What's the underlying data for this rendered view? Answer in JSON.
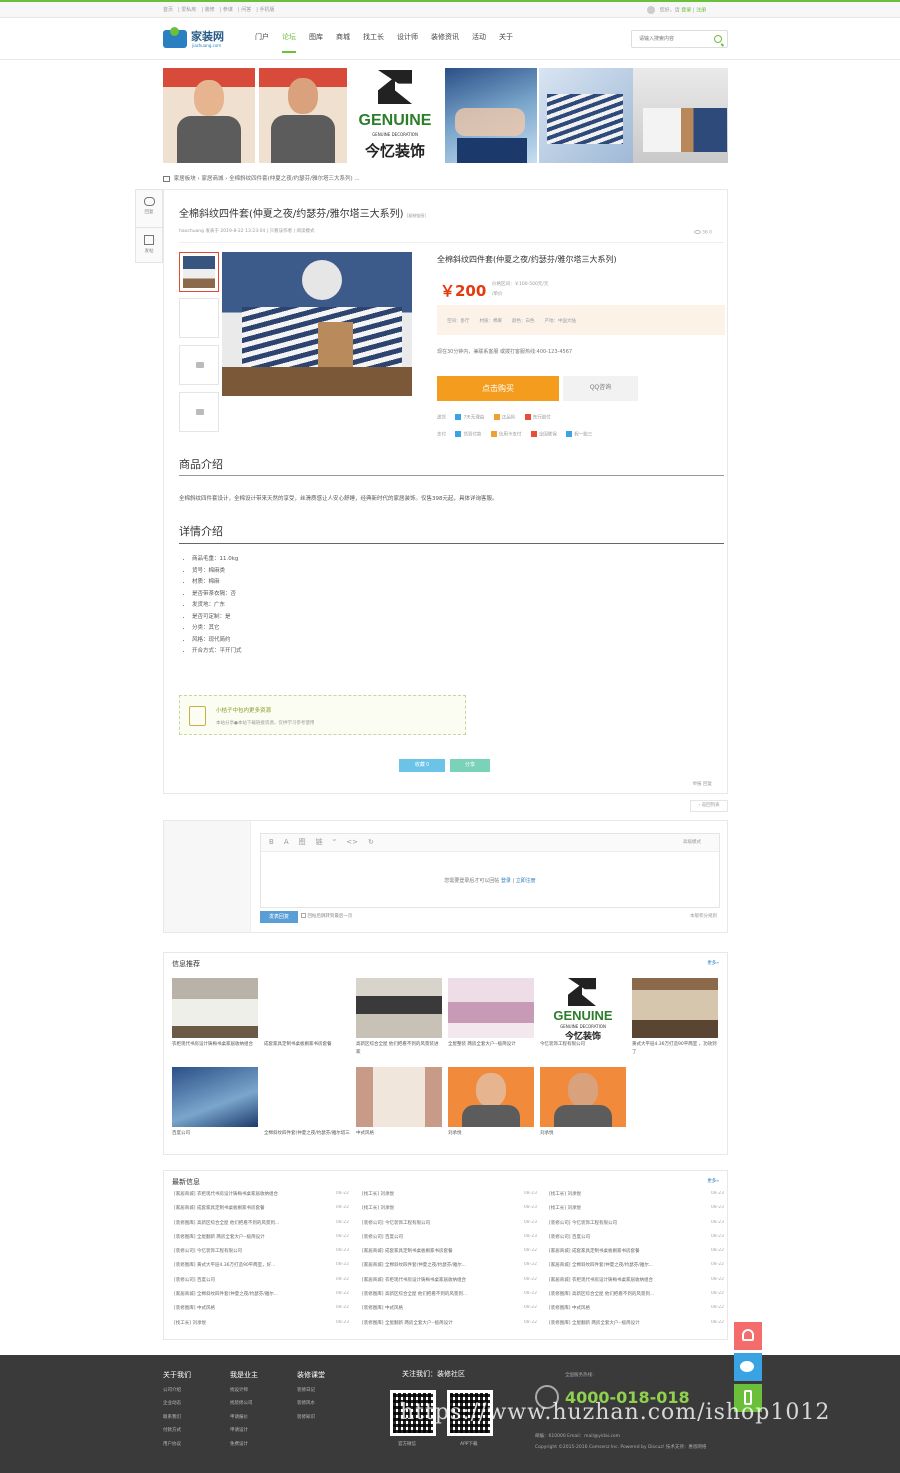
{
  "topbar": {
    "links": [
      "首页",
      "爱私房",
      "装修",
      "参谋",
      "问答",
      "手机版"
    ],
    "greeting": "您好，请",
    "login": "登录",
    "register": "注册"
  },
  "logo": {
    "name": "家装网",
    "domain": "jiazhuang.com"
  },
  "nav": [
    "门户",
    "论坛",
    "图库",
    "商城",
    "找工长",
    "设计师",
    "装修资讯",
    "活动",
    "关于"
  ],
  "search": {
    "placeholder": "请输入搜索内容"
  },
  "banner": {
    "genuine": "GENUINE",
    "genuine_sub": "GENUINE DECORATION",
    "genuine_cn": "今忆装饰"
  },
  "breadcrumb": "家居板块 › 家居商城 › 全棉斜纹四件套(仲夏之夜/约瑟芬/雅尔塔三大系列) ...",
  "sidetools": [
    "回复",
    "发帖"
  ],
  "post": {
    "title": "全棉斜纹四件套(仲夏之夜/约瑟芬/雅尔塔三大系列)",
    "title_tag": "[复制链接]",
    "meta": "haochuang  发表于 2019-8-22 13:23:04  |  只看该作者  |  阅读模式",
    "stats": "36    0",
    "product_title": "全棉斜纹四件套(仲夏之夜/约瑟芬/雅尔塔三大系列)",
    "price": "￥200",
    "price_range": "价格区间：￥100-500元/元",
    "unit": "/单价",
    "attrs": [
      "空间：卧厅",
      "材质：棉麻",
      "颜色：白色",
      "产地：中国大陆"
    ],
    "desc": "现在30分钟内，兼联系客服 或拨打客服热线:400-123-4567",
    "buy": "点击购买",
    "qq": "QQ咨询",
    "service_rows": [
      {
        "label": "送货",
        "items": [
          "7天无理由",
          "正品险",
          "先行赔付"
        ]
      },
      {
        "label": "支付",
        "items": [
          "货到付款",
          "信用卡支付",
          "全国联保",
          "假一赔三"
        ]
      }
    ],
    "intro_head": "商品介绍",
    "intro": "全棉斜纹四件套设计，全棉设计带来天然的享受，丝滑质感让人安心舒睡，经典新时代的家居装饰。仅售398元起，具体详询客服。",
    "detail_head": "详情介绍",
    "details": [
      "商品毛重：11.0kg",
      "货号：棉麻类",
      "材质：棉麻",
      "是否带茶衣隔：否",
      "发货地：广东",
      "是否可定制：是",
      "分类：其它",
      "风格：现代简约",
      "开合方式：平开门式"
    ],
    "download_title": "小桔子中包内更多资源",
    "download_sub": "本站分享●本站下载链接资源，仅供学习参考使用",
    "fav": "收藏 0",
    "share": "分享",
    "footer_links": "举报    回复"
  },
  "back_list": "‹ 返回列表",
  "reply": {
    "toolbar": [
      "B",
      "A",
      "图",
      "链",
      "“",
      "<>",
      "↻"
    ],
    "advanced": "高级模式",
    "login_msg": "您需要登录后才可以回帖",
    "login": "登录",
    "sep": " | ",
    "register": "立即注册",
    "submit": "发表回复",
    "checkbox": "回帖后跳转到最后一页",
    "rules": "本版积分规则"
  },
  "info": {
    "title": "信息推荐",
    "more": "更多»",
    "cards": [
      "衣柜现代书房设计铸梅书桌家居收纳组合",
      "成套家具定制书桌板橱家书房套餐",
      "高新区综合全屋 他们把看不到的风景装进家",
      "全屋整装 两房全套大户--极简设计",
      "今忆装饰工程有限公司",
      "黄式大平层4.36万打造90平两室 ，功效到了",
      "百度公司",
      "全棉斜纹四件套(仲夏之夜/约瑟芬/雅尔塔三",
      "中式风格",
      "刘承悦",
      "刘承悦"
    ]
  },
  "latest": {
    "title": "最新信息",
    "more": "更多»",
    "cols": [
      [
        [
          "[家居商城] 衣柜现代书房设计铸梅书桌家居收纳组合",
          "08-22"
        ],
        [
          "[家居商城] 成套家具定制书桌板橱家书房套餐",
          "08-22"
        ],
        [
          "[装修图库] 高新区综合全屋 他们把看不到的风景到...",
          "08-22"
        ],
        [
          "[装修图库] 全屋翻新 两房全套大户--极简设计",
          "08-22"
        ],
        [
          "[装修公司] 今忆装饰工程有限公司",
          "08-23"
        ],
        [
          "[装修图库] 黄式大平层4.36万打造90平两室，好...",
          "08-22"
        ],
        [
          "[装修公司] 百度公司",
          "08-22"
        ],
        [
          "[家居商城] 全棉斜纹四件套(仲夏之夜/约瑟芬/雅尔...",
          "08-22"
        ],
        [
          "[装修图库] 中式风格",
          "08-22"
        ],
        [
          "[找工长] 刘承悦",
          "08-23"
        ]
      ],
      [
        [
          "[找工长] 刘承悦",
          "08-23"
        ],
        [
          "[找工长] 刘承悦",
          "08-23"
        ],
        [
          "[装修公司] 今忆装饰工程有限公司",
          "08-23"
        ],
        [
          "[装修公司] 百度公司",
          "08-23"
        ],
        [
          "[家居商城] 成套家具定制书桌板橱家书房套餐",
          "08-22"
        ],
        [
          "[家居商城] 全棉斜纹四件套(仲夏之夜/约瑟芬/雅尔...",
          "08-22"
        ],
        [
          "[家居商城] 衣柜现代书房设计铸梅书桌家居收纳组合",
          "08-22"
        ],
        [
          "[装修图库] 高新区综合全屋 他们把看不到的风景到...",
          "08-22"
        ],
        [
          "[装修图库] 中式风格",
          "08-22"
        ],
        [
          "[装修图库] 全屋翻新 两房全套大户--极简设计",
          "08-22"
        ]
      ],
      [
        [
          "[找工长] 刘承悦",
          "08-23"
        ],
        [
          "[找工长] 刘承悦",
          "08-23"
        ],
        [
          "[装修公司] 今忆装饰工程有限公司",
          "08-23"
        ],
        [
          "[装修公司] 百度公司",
          "08-23"
        ],
        [
          "[家居商城] 成套家具定制书桌板橱家书房套餐",
          "08-22"
        ],
        [
          "[家居商城] 全棉斜纹四件套(仲夏之夜/约瑟芬/雅尔...",
          "08-22"
        ],
        [
          "[家居商城] 衣柜现代书房设计铸梅书桌家居收纳组合",
          "08-22"
        ],
        [
          "[装修图库] 高新区综合全屋 他们把看不到的风景到...",
          "08-22"
        ],
        [
          "[装修图库] 中式风格",
          "08-22"
        ],
        [
          "[装修图库] 全屋翻新 两房全套大户--极简设计",
          "08-22"
        ]
      ]
    ]
  },
  "footer": {
    "col1": {
      "h": "关于我们",
      "items": [
        "公司介绍",
        "企业动态",
        "联系我们",
        "付款方式",
        "用户协议"
      ]
    },
    "col2": {
      "h": "我是业主",
      "items": [
        "找设计师",
        "找装修公司",
        "申请报价",
        "申请设计",
        "免费设计"
      ]
    },
    "col3": {
      "h": "装修课堂",
      "items": [
        "装修日记",
        "装修风水",
        "装修知识"
      ]
    },
    "follow": "关注我们：装修社区",
    "qr": [
      "官方微信",
      "APP下载"
    ],
    "hotline_label": "全国服务热线：",
    "phone": "4000-018-018",
    "addr": "邮编：610000 Email：mail@yidai.com",
    "copyright": "Copyright ©2015-2016 Comsenz Inc. Powered by Discuz! 技术支持：惠恩网络"
  },
  "watermark": "https://www.huzhan.com/ishop1012"
}
